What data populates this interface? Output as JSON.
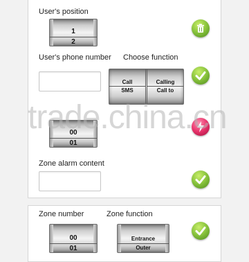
{
  "section1": {
    "user_position_label": "User's position",
    "user_position_options": [
      "1",
      "2"
    ],
    "phone_label": "User's phone number",
    "phone_value": "",
    "choose_function_label": "Choose function",
    "function_left": [
      "Call",
      "SMS"
    ],
    "function_right": [
      "Calling",
      "Call to"
    ],
    "zone_picker_options": [
      "00",
      "01"
    ],
    "alarm_content_label": "Zone alarm content",
    "alarm_content_value": ""
  },
  "section2": {
    "zone_number_label": "Zone number",
    "zone_number_options": [
      "00",
      "01"
    ],
    "zone_function_label": "Zone function",
    "zone_function_options": [
      "Entrance",
      "Outer"
    ]
  },
  "watermark": "trade.china.cn",
  "buttons": {
    "delete_icon": "trash-icon",
    "confirm_icon": "checkmark-icon",
    "alert_icon": "lightning-icon",
    "green": "#8cc63f",
    "red": "#e8336b"
  }
}
